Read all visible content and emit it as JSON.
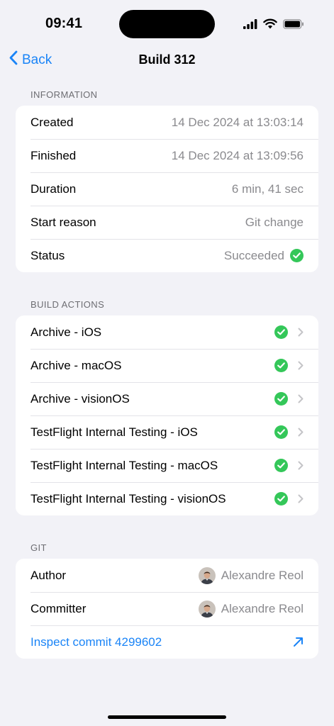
{
  "status_bar": {
    "time": "09:41"
  },
  "nav": {
    "back_label": "Back",
    "title": "Build 312"
  },
  "information": {
    "header": "INFORMATION",
    "rows": [
      {
        "label": "Created",
        "value": "14 Dec 2024 at 13:03:14"
      },
      {
        "label": "Finished",
        "value": "14 Dec 2024 at 13:09:56"
      },
      {
        "label": "Duration",
        "value": "6 min, 41 sec"
      },
      {
        "label": "Start reason",
        "value": "Git change"
      },
      {
        "label": "Status",
        "value": "Succeeded"
      }
    ]
  },
  "build_actions": {
    "header": "BUILD ACTIONS",
    "items": [
      {
        "label": "Archive - iOS",
        "status": "succeeded"
      },
      {
        "label": "Archive - macOS",
        "status": "succeeded"
      },
      {
        "label": "Archive - visionOS",
        "status": "succeeded"
      },
      {
        "label": "TestFlight Internal Testing - iOS",
        "status": "succeeded"
      },
      {
        "label": "TestFlight Internal Testing - macOS",
        "status": "succeeded"
      },
      {
        "label": "TestFlight Internal Testing - visionOS",
        "status": "succeeded"
      }
    ]
  },
  "git": {
    "header": "GIT",
    "author_label": "Author",
    "author_name": "Alexandre Reol",
    "committer_label": "Committer",
    "committer_name": "Alexandre Reol",
    "inspect_link": "Inspect commit 4299602"
  },
  "colors": {
    "accent": "#1a84f7",
    "success": "#34c759",
    "background": "#f2f2f7"
  }
}
